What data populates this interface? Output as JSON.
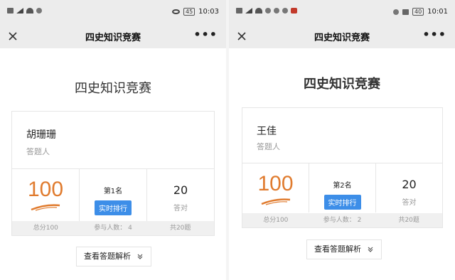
{
  "panels": [
    {
      "status": {
        "left": "5G ᵢₗ",
        "battery": "45",
        "time": "10:03"
      },
      "nav": {
        "title": "四史知识竞赛"
      },
      "page_title": "四史知识竞赛",
      "user": {
        "name": "胡珊珊",
        "role": "答题人"
      },
      "score": "100",
      "rank": "第1名",
      "rank_button": "实时排行",
      "correct": {
        "value": "20",
        "label": "答对"
      },
      "footer": {
        "total_score": "总分100",
        "participants": "参与人数： 4",
        "total_questions": "共20题"
      },
      "analysis_button": "查看答题解析"
    },
    {
      "status": {
        "left": "5G ᵢₗ",
        "battery": "40",
        "time": "10:01"
      },
      "nav": {
        "title": "四史知识竞赛"
      },
      "page_title": "四史知识竞赛",
      "user": {
        "name": "王佳",
        "role": "答题人"
      },
      "score": "100",
      "rank": "第2名",
      "rank_button": "实时排行",
      "correct": {
        "value": "20",
        "label": "答对"
      },
      "footer": {
        "total_score": "总分100",
        "participants": "参与人数： 2",
        "total_questions": "共20题"
      },
      "analysis_button": "查看答题解析"
    }
  ],
  "colors": {
    "score": "#e07b2e",
    "button_blue": "#3d8ee8",
    "navbar": "#ececec"
  },
  "icons": [
    "close-icon",
    "more-icon",
    "chevron-down-icon",
    "signal-icon",
    "wifi-icon",
    "eye-icon",
    "battery-icon"
  ]
}
